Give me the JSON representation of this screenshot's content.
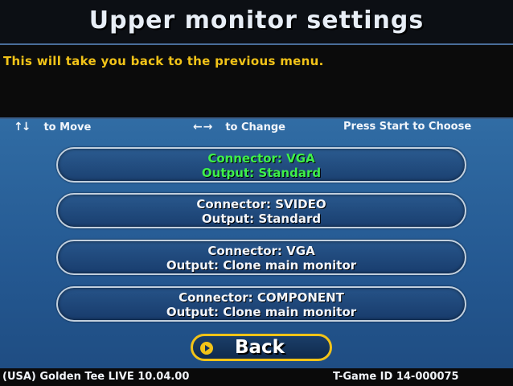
{
  "header": {
    "title": "Upper monitor settings"
  },
  "description": {
    "text": "This will take you back to the previous menu."
  },
  "help": {
    "move_icon": "up-down-arrows-icon",
    "move_label": "to Move",
    "change_icon": "left-right-arrows-icon",
    "change_label": "to Change",
    "start_label": "Press Start to Choose"
  },
  "options": [
    {
      "connector": "Connector: VGA",
      "output": "Output: Standard",
      "selected": true
    },
    {
      "connector": "Connector: SVIDEO",
      "output": "Output: Standard",
      "selected": false
    },
    {
      "connector": "Connector: VGA",
      "output": "Output: Clone main monitor",
      "selected": false
    },
    {
      "connector": "Connector: COMPONENT",
      "output": "Output: Clone main monitor",
      "selected": false
    }
  ],
  "back": {
    "label": "Back",
    "icon": "play-circle-icon"
  },
  "footer": {
    "version": "(USA) Golden Tee LIVE 10.04.00",
    "game_id": "T-Game ID 14-000075"
  },
  "colors": {
    "selected_text": "#3ef04a",
    "accent_yellow": "#f2c318",
    "background": "#2f6aa2"
  }
}
